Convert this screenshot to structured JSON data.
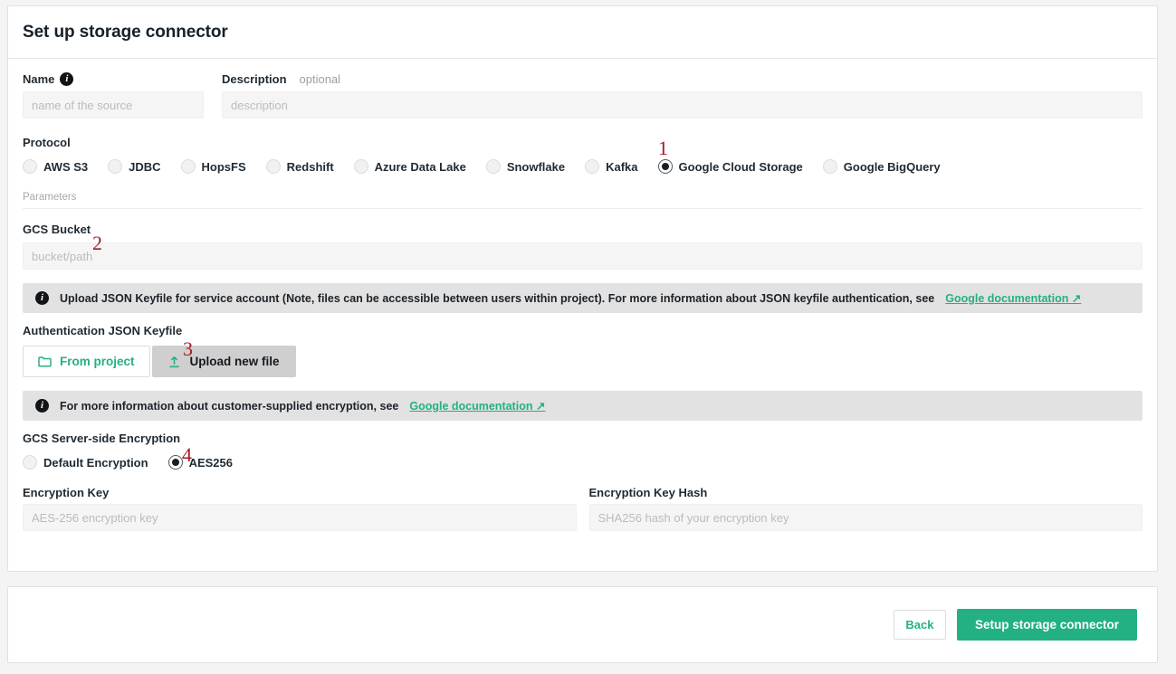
{
  "header": {
    "title": "Set up storage connector"
  },
  "name_field": {
    "label": "Name",
    "info_icon": "info-icon",
    "placeholder": "name of the source",
    "value": ""
  },
  "description_field": {
    "label": "Description",
    "optional": "optional",
    "placeholder": "description",
    "value": ""
  },
  "protocol": {
    "label": "Protocol",
    "selected": "Google Cloud Storage",
    "options": [
      {
        "label": "AWS S3",
        "checked": false
      },
      {
        "label": "JDBC",
        "checked": false
      },
      {
        "label": "HopsFS",
        "checked": false
      },
      {
        "label": "Redshift",
        "checked": false
      },
      {
        "label": "Azure Data Lake",
        "checked": false
      },
      {
        "label": "Snowflake",
        "checked": false
      },
      {
        "label": "Kafka",
        "checked": false
      },
      {
        "label": "Google Cloud Storage",
        "checked": true
      },
      {
        "label": "Google BigQuery",
        "checked": false
      }
    ]
  },
  "parameters": {
    "label": "Parameters"
  },
  "gcs_bucket": {
    "label": "GCS Bucket",
    "placeholder": "bucket/path",
    "value": ""
  },
  "keyfile_banner": {
    "icon": "info-icon",
    "text": "Upload JSON Keyfile for service account (Note, files can be accessible between users within project). For more information about JSON keyfile authentication, see",
    "link": "Google documentation ↗"
  },
  "keyfile": {
    "label": "Authentication JSON Keyfile",
    "from_project_button": "From project",
    "from_project_icon": "folder-icon",
    "upload_button": "Upload new file",
    "upload_icon": "upload-icon"
  },
  "encryption_banner": {
    "icon": "info-icon",
    "text": "For more information about customer-supplied encryption, see",
    "link": "Google documentation ↗"
  },
  "encryption": {
    "label": "GCS Server-side Encryption",
    "selected": "AES256",
    "options": [
      {
        "label": "Default Encryption",
        "checked": false
      },
      {
        "label": "AES256",
        "checked": true
      }
    ]
  },
  "encryption_key": {
    "label": "Encryption Key",
    "placeholder": "AES-256 encryption key",
    "value": ""
  },
  "encryption_key_hash": {
    "label": "Encryption Key Hash",
    "placeholder": "SHA256 hash of your encryption key",
    "value": ""
  },
  "footer": {
    "back_label": "Back",
    "submit_label": "Setup storage connector"
  },
  "annotations": [
    {
      "id": "1",
      "label": "1"
    },
    {
      "id": "2",
      "label": "2"
    },
    {
      "id": "3",
      "label": "3"
    },
    {
      "id": "4",
      "label": "4"
    }
  ],
  "colors": {
    "accent_green": "#23b085",
    "page_background": "#f4f4f4",
    "card_background": "#ffffff",
    "input_background": "#f5f5f5",
    "banner_background": "#e2e2e2",
    "annotation_red": "#a11d26",
    "pressed_button": "#cfcfcf"
  }
}
